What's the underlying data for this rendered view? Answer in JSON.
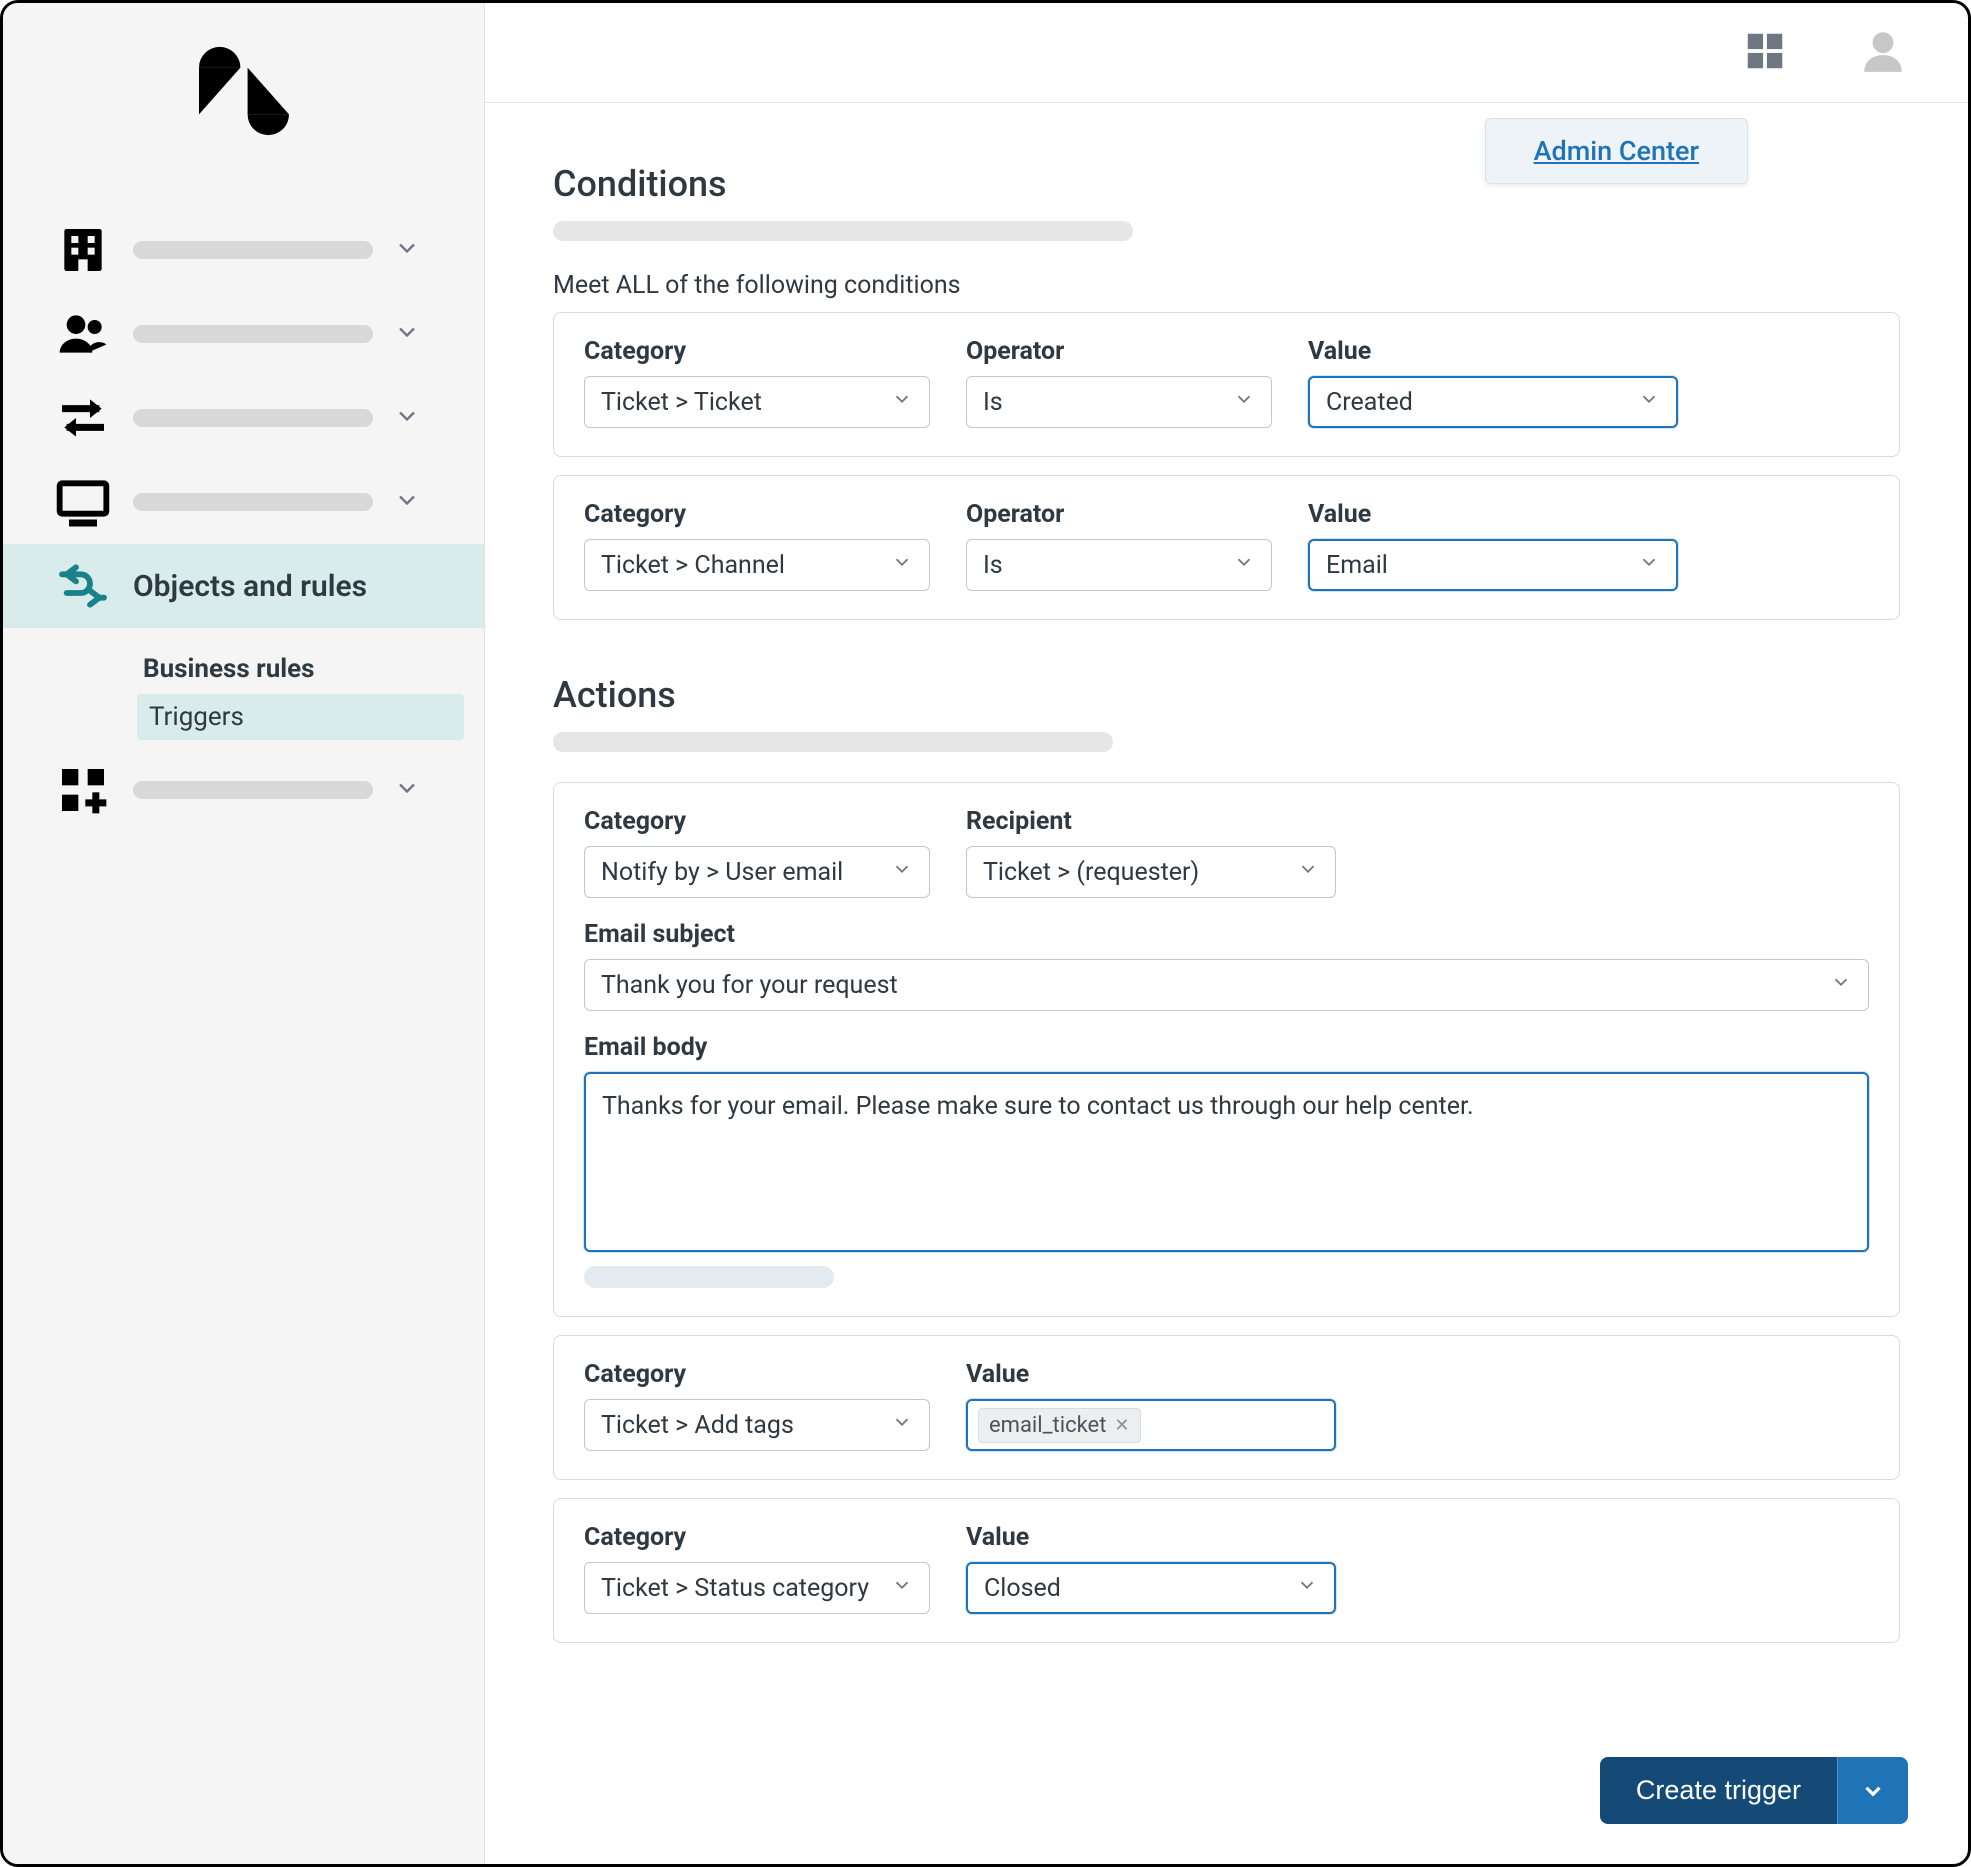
{
  "header": {
    "admin_center": "Admin Center"
  },
  "sidebar": {
    "active_label": "Objects and rules",
    "sub_heading": "Business rules",
    "sub_item": "Triggers"
  },
  "conditions": {
    "title": "Conditions",
    "all_label": "Meet ALL of the following conditions",
    "rows": [
      {
        "category_label": "Category",
        "category_value": "Ticket > Ticket",
        "operator_label": "Operator",
        "operator_value": "Is",
        "value_label": "Value",
        "value_value": "Created"
      },
      {
        "category_label": "Category",
        "category_value": "Ticket > Channel",
        "operator_label": "Operator",
        "operator_value": "Is",
        "value_label": "Value",
        "value_value": "Email"
      }
    ]
  },
  "actions": {
    "title": "Actions",
    "notify": {
      "category_label": "Category",
      "category_value": "Notify by > User email",
      "recipient_label": "Recipient",
      "recipient_value": "Ticket > (requester)",
      "subject_label": "Email subject",
      "subject_value": "Thank you for your request",
      "body_label": "Email body",
      "body_value": "Thanks for your email. Please make sure to contact us through our help center."
    },
    "tags": {
      "category_label": "Category",
      "category_value": "Ticket > Add tags",
      "value_label": "Value",
      "tag": "email_ticket"
    },
    "status": {
      "category_label": "Category",
      "category_value": "Ticket > Status category",
      "value_label": "Value",
      "value_value": "Closed"
    }
  },
  "footer": {
    "create": "Create trigger"
  }
}
